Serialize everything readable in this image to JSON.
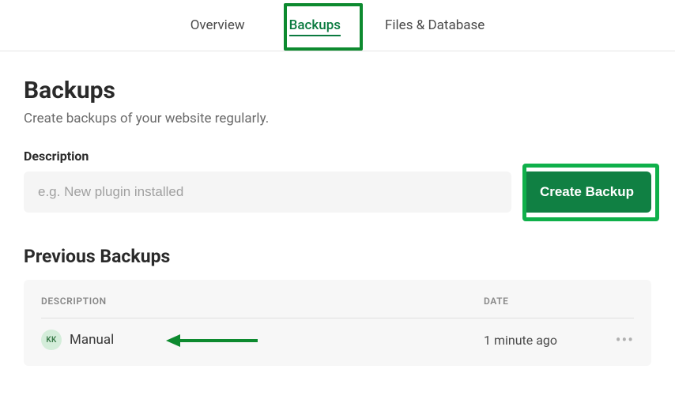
{
  "tabs": {
    "items": [
      {
        "label": "Overview",
        "active": false
      },
      {
        "label": "Backups",
        "active": true
      },
      {
        "label": "Files & Database",
        "active": false
      }
    ]
  },
  "page": {
    "title": "Backups",
    "subtitle": "Create backups of your website regularly."
  },
  "form": {
    "description_label": "Description",
    "description_placeholder": "e.g. New plugin installed",
    "create_button_label": "Create Backup"
  },
  "previous": {
    "title": "Previous Backups",
    "columns": {
      "description": "DESCRIPTION",
      "date": "DATE"
    },
    "rows": [
      {
        "avatar_initials": "KK",
        "description": "Manual",
        "date": "1 minute ago"
      }
    ]
  },
  "icons": {
    "more": "•••"
  },
  "colors": {
    "accent": "#108043",
    "highlight_border": "#0fb04a",
    "arrow": "#0d8a2f"
  }
}
